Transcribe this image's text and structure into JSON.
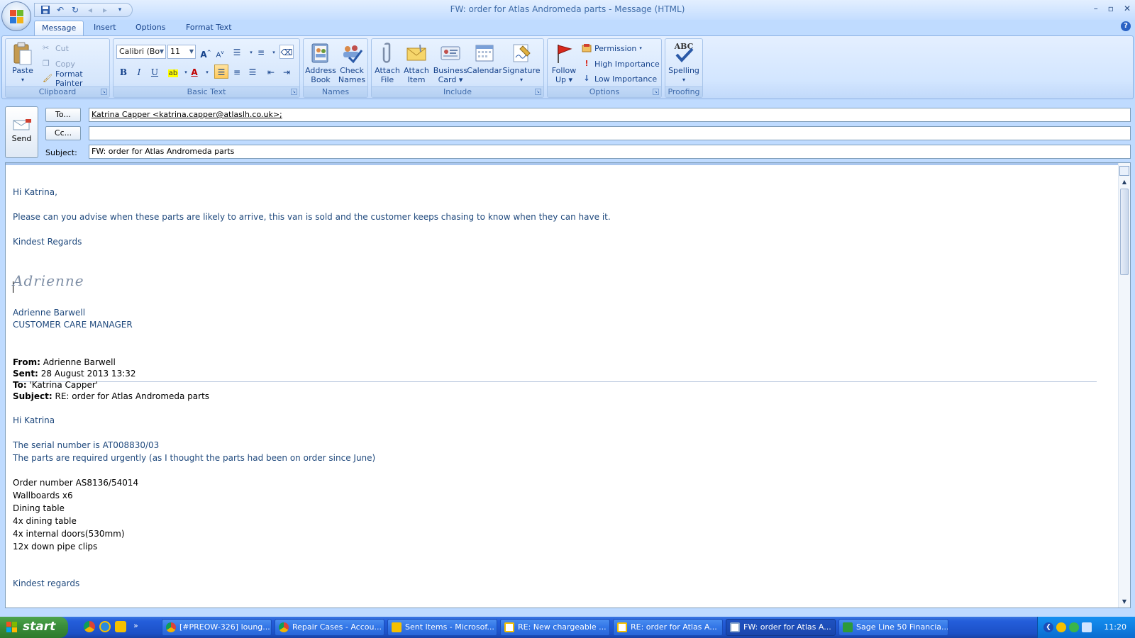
{
  "window": {
    "title": "FW: order for Atlas Andromeda parts - Message (HTML)",
    "controls": [
      "–",
      "▫",
      "✕"
    ]
  },
  "tabs": [
    {
      "label": "Message",
      "active": true
    },
    {
      "label": "Insert"
    },
    {
      "label": "Options"
    },
    {
      "label": "Format Text"
    }
  ],
  "ribbon": {
    "clipboard": {
      "label": "Clipboard",
      "paste": "Paste",
      "cut": "Cut",
      "copy": "Copy",
      "format_painter": "Format Painter"
    },
    "basic_text": {
      "label": "Basic Text",
      "font": "Calibri (Bo",
      "size": "11",
      "bold": "B",
      "italic": "I",
      "underline": "U"
    },
    "names": {
      "label": "Names",
      "address_book_1": "Address",
      "address_book_2": "Book",
      "check_names_1": "Check",
      "check_names_2": "Names"
    },
    "include": {
      "label": "Include",
      "attach_file_1": "Attach",
      "attach_file_2": "File",
      "attach_item_1": "Attach",
      "attach_item_2": "Item",
      "business_card_1": "Business",
      "business_card_2": "Card ▾",
      "calendar": "Calendar",
      "signature": "Signature"
    },
    "follow_up": {
      "line1": "Follow",
      "line2": "Up ▾"
    },
    "options": {
      "label": "Options",
      "permission": "Permission",
      "high_importance": "High Importance",
      "low_importance": "Low Importance"
    },
    "proofing": {
      "label": "Proofing",
      "spelling": "Spelling",
      "abc": "ABC"
    }
  },
  "header": {
    "send_label": "Send",
    "to_button": "To...",
    "cc_button": "Cc...",
    "subject_label": "Subject:",
    "to_value": "Katrina Capper <katrina.capper@atlaslh.co.uk>;",
    "cc_value": "",
    "subject_value": "FW: order for Atlas Andromeda parts"
  },
  "body": {
    "greeting": "Hi Katrina,",
    "paragraph": "Please can you advise when these parts are likely to arrive,  this van is sold and the customer  keeps chasing to know when they can have it.",
    "closing": "Kindest Regards",
    "signature_script": "Adrienne",
    "sig_name": "Adrienne Barwell",
    "sig_title": "CUSTOMER CARE MANAGER",
    "forwarded": {
      "from_label": "From:",
      "from_value": "Adrienne Barwell",
      "sent_label": "Sent:",
      "sent_value": "28 August 2013 13:32",
      "to_label": "To:",
      "to_value": "'Katrina Capper'",
      "subject_label": "Subject:",
      "subject_value": "RE: order for Atlas Andromeda parts",
      "greeting": "Hi Katrina",
      "serial": "The serial number is AT008830/03",
      "urgent": "The parts are required urgently (as I thought the parts had been on order since June)",
      "order_number": "Order number AS8136/54014",
      "items": [
        "Wallboards x6",
        "Dining table",
        "4x dining table",
        "4x internal doors(530mm)",
        "12x down pipe clips"
      ],
      "closing": "Kindest regards"
    }
  },
  "taskbar": {
    "start_label": "start",
    "more_glyph": "»",
    "tasks": [
      {
        "label": "[#PREOW-326] loung...",
        "icon": "chrome-icon"
      },
      {
        "label": "Repair Cases - Accou...",
        "icon": "chrome-icon"
      },
      {
        "label": "Sent Items - Microsof...",
        "icon": "outlook-icon"
      },
      {
        "label": "RE: New chargeable ...",
        "icon": "mail-icon"
      },
      {
        "label": "RE: order for Atlas A...",
        "icon": "mail-icon"
      },
      {
        "label": "FW: order for Atlas A...",
        "icon": "mail-icon",
        "active": true
      },
      {
        "label": "Sage Line 50 Financia...",
        "icon": "sage-icon"
      }
    ],
    "clock": "11:20"
  }
}
